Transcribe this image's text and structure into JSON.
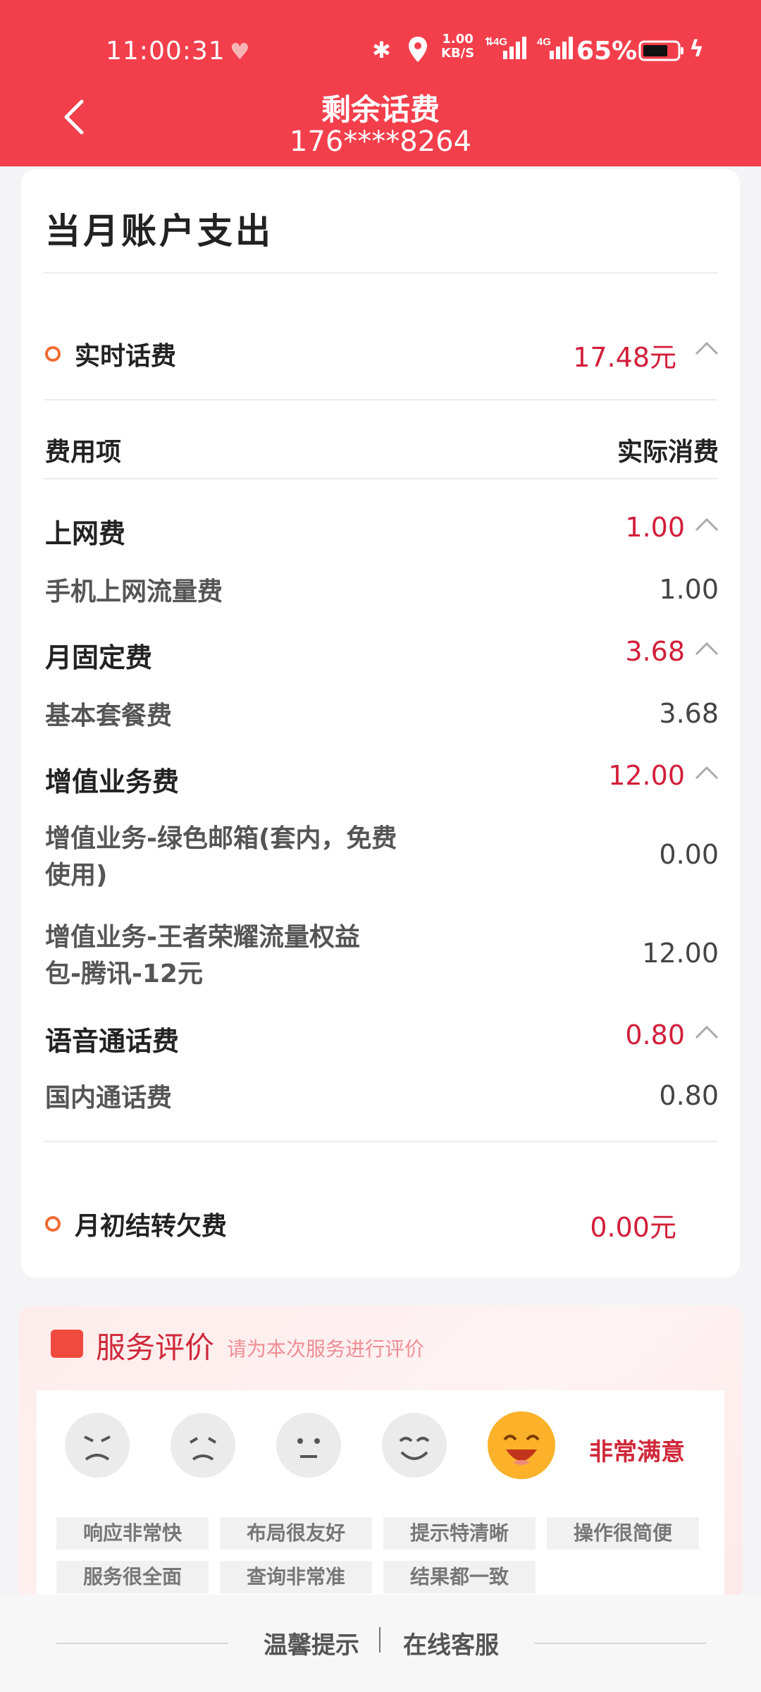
{
  "status_bar": {
    "time": "11:00:31",
    "net_speed_value": "1.00",
    "net_speed_unit": "KB/S",
    "net_type_1": "4G",
    "net_type_2": "4G",
    "battery": "65%"
  },
  "header": {
    "title": "剩余话费",
    "phone": "176****8264"
  },
  "card": {
    "title": "当月账户支出",
    "realtime_label": "实时话费",
    "realtime_amount": "17.48元",
    "col_item": "费用项",
    "col_actual": "实际消费",
    "categories": [
      {
        "name": "上网费",
        "amount": "1.00"
      },
      {
        "name": "月固定费",
        "amount": "3.68"
      },
      {
        "name": "增值业务费",
        "amount": "12.00"
      },
      {
        "name": "语音通话费",
        "amount": "0.80"
      }
    ],
    "items": [
      {
        "line1": "手机上网流量费",
        "line2": "",
        "amount": "1.00"
      },
      {
        "line1": "基本套餐费",
        "line2": "",
        "amount": "3.68"
      },
      {
        "line1": "增值业务-绿色邮箱(套内，免费",
        "line2": "使用)",
        "amount": "0.00"
      },
      {
        "line1": "增值业务-王者荣耀流量权益",
        "line2": "包-腾讯-12元",
        "amount": "12.00"
      },
      {
        "line1": "国内通话费",
        "line2": "",
        "amount": "0.80"
      }
    ],
    "arrears_label": "月初结转欠费",
    "arrears_amount": "0.00元"
  },
  "evaluation": {
    "title": "服务评价",
    "subtitle": "请为本次服务进行评价",
    "selected_label": "非常满意",
    "tags": [
      "响应非常快",
      "布局很友好",
      "提示特清晰",
      "操作很简便",
      "服务很全面",
      "查询非常准",
      "结果都一致"
    ]
  },
  "footer": {
    "tips": "温馨提示",
    "service": "在线客服"
  },
  "colors": {
    "header_bg": "#f33f4c",
    "amount_red": "#d21e3a",
    "dot_orange": "#f26a2f"
  }
}
